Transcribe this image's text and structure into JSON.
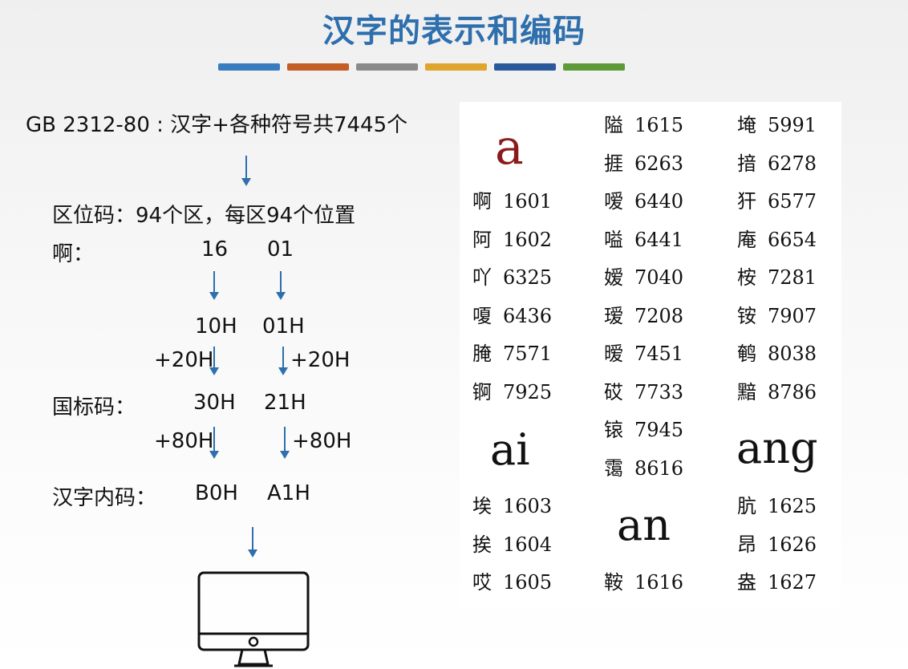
{
  "title": "汉字的表示和编码",
  "bars": [
    "#3a7dbf",
    "#c45d26",
    "#8a8a8a",
    "#e0a52c",
    "#2a5a9c",
    "#5e9a38"
  ],
  "left": {
    "gb_line": "GB 2312-80 : 汉字+各种符号共7445个",
    "quwei_line": "区位码：94个区，每区94个位置",
    "a_char": "啊：",
    "qu": "16",
    "wei": "01",
    "hex_qu": "10H",
    "hex_wei": "01H",
    "plus20_left": "+20H",
    "plus20_right": "+20H",
    "guobiao_label": "国标码：",
    "gb_qu": "30H",
    "gb_wei": "21H",
    "plus80_left": "+80H",
    "plus80_right": "+80H",
    "neima_label": "汉字内码：",
    "nm_qu": "B0H",
    "nm_wei": "A1H",
    "monitor_icon": "monitor-icon"
  },
  "table": {
    "col1": {
      "header": "a",
      "items": [
        {
          "char": "啊",
          "code": "1601"
        },
        {
          "char": "阿",
          "code": "1602"
        },
        {
          "char": "吖",
          "code": "6325"
        },
        {
          "char": "嗄",
          "code": "6436"
        },
        {
          "char": "腌",
          "code": "7571"
        },
        {
          "char": "锕",
          "code": "7925"
        }
      ],
      "header2": "ai",
      "items2": [
        {
          "char": "埃",
          "code": "1603"
        },
        {
          "char": "挨",
          "code": "1604"
        },
        {
          "char": "哎",
          "code": "1605"
        }
      ]
    },
    "col2": {
      "items": [
        {
          "char": "隘",
          "code": "1615"
        },
        {
          "char": "捱",
          "code": "6263"
        },
        {
          "char": "嗳",
          "code": "6440"
        },
        {
          "char": "嗌",
          "code": "6441"
        },
        {
          "char": "嫒",
          "code": "7040"
        },
        {
          "char": "瑷",
          "code": "7208"
        },
        {
          "char": "暧",
          "code": "7451"
        },
        {
          "char": "砹",
          "code": "7733"
        },
        {
          "char": "锿",
          "code": "7945"
        },
        {
          "char": "霭",
          "code": "8616"
        }
      ],
      "header": "an",
      "items2": [
        {
          "char": "鞍",
          "code": "1616"
        }
      ]
    },
    "col3": {
      "items": [
        {
          "char": "埯",
          "code": "5991"
        },
        {
          "char": "揞",
          "code": "6278"
        },
        {
          "char": "犴",
          "code": "6577"
        },
        {
          "char": "庵",
          "code": "6654"
        },
        {
          "char": "桉",
          "code": "7281"
        },
        {
          "char": "铵",
          "code": "7907"
        },
        {
          "char": "鹌",
          "code": "8038"
        },
        {
          "char": "黯",
          "code": "8786"
        }
      ],
      "header": "ang",
      "items2": [
        {
          "char": "肮",
          "code": "1625"
        },
        {
          "char": "昂",
          "code": "1626"
        },
        {
          "char": "盎",
          "code": "1627"
        }
      ]
    }
  }
}
